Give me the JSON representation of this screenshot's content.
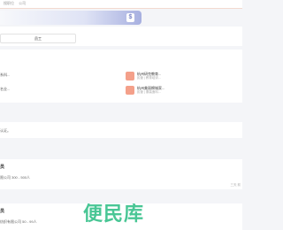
{
  "topbar": {
    "nav": [
      "",
      "搜职位",
      "公司"
    ]
  },
  "banner": {
    "badge": "$"
  },
  "filter": {
    "label": "员工"
  },
  "companies": {
    "left": [
      {
        "text": "系科..."
      },
      {
        "text": "名业..."
      }
    ],
    "items": [
      {
        "logo": "",
        "name": "杭州研克教育...",
        "sub": "民营 | 教育培训..."
      },
      {
        "logo": "",
        "name": "杭州美丽棉城家...",
        "sub": "民营 | 服装面料..."
      }
    ]
  },
  "note": {
    "text": "认证。"
  },
  "jobs": [
    {
      "title": "员",
      "meta": "限公司  300 - 500人",
      "right": "三天 前"
    },
    {
      "title": "员",
      "meta": "纺织有限公司  50 - 99人",
      "right": ""
    }
  ],
  "watermark": "便民库"
}
